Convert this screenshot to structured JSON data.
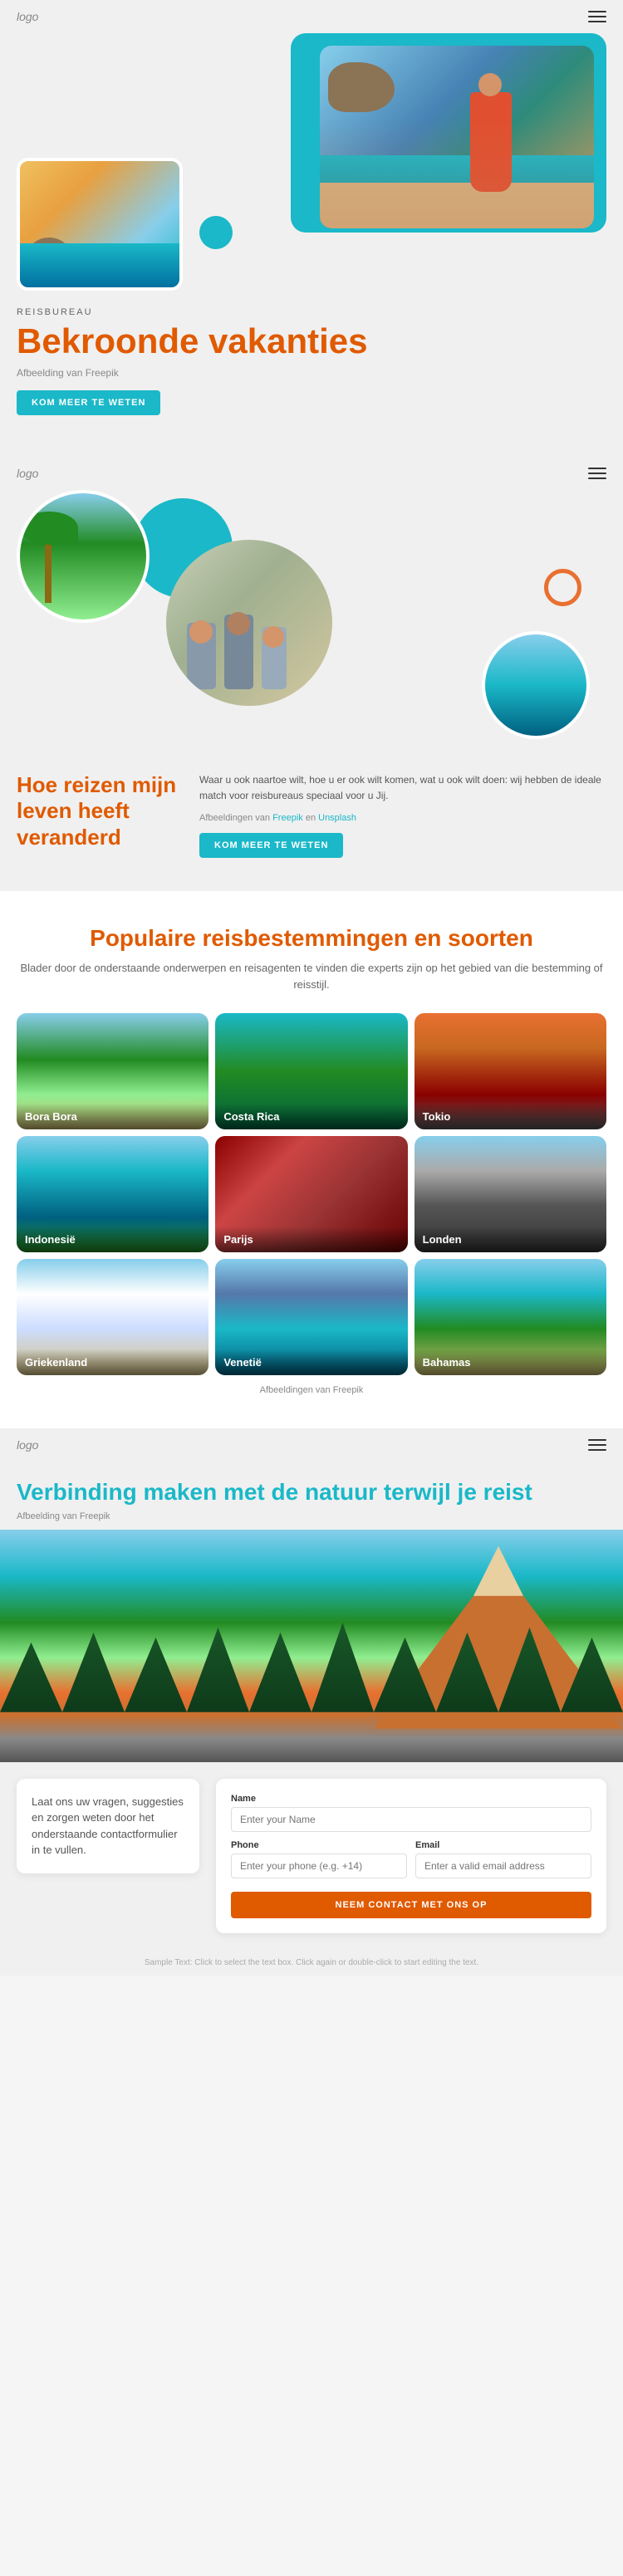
{
  "section1": {
    "nav": {
      "logo": "logo",
      "menu_icon": "≡"
    },
    "label": "REISBUREAU",
    "title": "Bekroonde vakanties",
    "image_credit": "Afbeelding van Freepik",
    "btn_label": "KOM MEER TE WETEN"
  },
  "section2": {
    "nav": {
      "logo": "logo",
      "menu_icon": "≡"
    },
    "title": "Hoe reizen mijn leven heeft veranderd",
    "body": "Waar u ook naartoe wilt, hoe u er ook wilt komen, wat u ook wilt doen: wij hebben de ideale match voor reisbureaus speciaal voor u Jij.",
    "credits_prefix": "Afbeeldingen van ",
    "credits_freepik": "Freepik",
    "credits_and": " en ",
    "credits_unsplash": "Unsplash",
    "btn_label": "KOM MEER TE WETEN",
    "logo": "logo"
  },
  "section3": {
    "title": "Populaire reisbestemmingen en soorten",
    "subtitle": "Blader door de onderstaande onderwerpen en reisagenten te vinden die experts zijn op het gebied van die bestemming of reisstijl.",
    "destinations": [
      {
        "name": "Bora Bora",
        "class": "dest-borabora"
      },
      {
        "name": "Costa Rica",
        "class": "dest-costarica"
      },
      {
        "name": "Tokio",
        "class": "dest-tokio"
      },
      {
        "name": "Indonesië",
        "class": "dest-indonesie"
      },
      {
        "name": "Parijs",
        "class": "dest-parijs"
      },
      {
        "name": "Londen",
        "class": "dest-londen"
      },
      {
        "name": "Griekenland",
        "class": "dest-griekenland"
      },
      {
        "name": "Venetië",
        "class": "dest-venetie"
      },
      {
        "name": "Bahamas",
        "class": "dest-bahamas"
      }
    ],
    "image_credit": "Afbeeldingen van Freepik"
  },
  "section4": {
    "nav": {
      "logo": "logo",
      "menu_icon": "≡"
    },
    "title": "Verbinding maken met de natuur terwijl je reist",
    "image_credit": "Afbeelding van Freepik",
    "contact_left_text": "Laat ons uw vragen, suggesties en zorgen weten door het onderstaande contactformulier in te vullen.",
    "form": {
      "name_label": "Name",
      "name_placeholder": "Enter your Name",
      "phone_label": "Phone",
      "phone_placeholder": "Enter your phone (e.g. +14)",
      "email_label": "Email",
      "email_placeholder": "Enter a valid email address",
      "btn_label": "NEEM CONTACT MET ONS OP"
    },
    "footer_text": "Sample Text: Click to select the text box. Click again or double-click to start editing the text."
  },
  "colors": {
    "teal": "#1ab8c8",
    "orange": "#e05a00",
    "light_orange": "#e87030"
  }
}
